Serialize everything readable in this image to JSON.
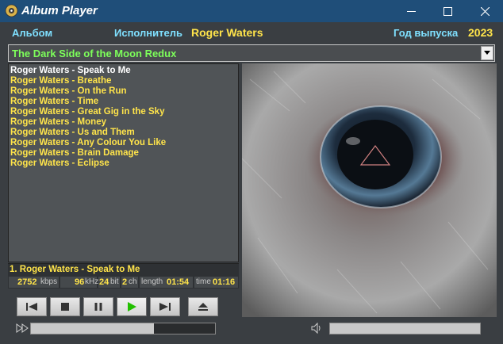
{
  "window": {
    "title": "Album Player"
  },
  "header": {
    "album_label": "Альбом",
    "artist_label": "Исполнитель",
    "artist_value": "Roger Waters",
    "year_label": "Год выпуска",
    "year_value": "2023"
  },
  "album_select": {
    "value": "The Dark Side of the Moon Redux"
  },
  "playlist": {
    "tracks": [
      "Roger Waters - Speak to Me",
      "Roger Waters - Breathe",
      "Roger Waters - On the Run",
      "Roger Waters - Time",
      "Roger Waters - Great Gig in the Sky",
      "Roger Waters - Money",
      "Roger Waters - Us and Them",
      "Roger Waters - Any Colour You Like",
      "Roger Waters - Brain Damage",
      "Roger Waters - Eclipse"
    ],
    "current_index": 0
  },
  "now_playing": {
    "text": "1.  Roger Waters - Speak to Me"
  },
  "info": {
    "bitrate": "2752",
    "bitrate_unit": "kbps",
    "samplerate": "96",
    "samplerate_unit": "kHz",
    "bits": "24",
    "bits_unit": "bit",
    "channels": "2",
    "channels_unit": "ch",
    "length_label": "length",
    "length": "01:54",
    "time_label": "time",
    "time": "01:16"
  },
  "progress": {
    "fraction": 0.667
  },
  "volume": {
    "fraction": 1.0
  },
  "icons": {
    "app": "disc-icon",
    "prev": "skip-back-icon",
    "stop": "stop-icon",
    "pause": "pause-icon",
    "play": "play-icon",
    "next": "skip-forward-icon",
    "eject": "eject-icon",
    "seek": "fast-forward-icon",
    "volume": "speaker-icon"
  },
  "colors": {
    "label": "#7fe0ff",
    "value": "#ffe44a",
    "album": "#7dff5a",
    "play": "#22c000"
  }
}
